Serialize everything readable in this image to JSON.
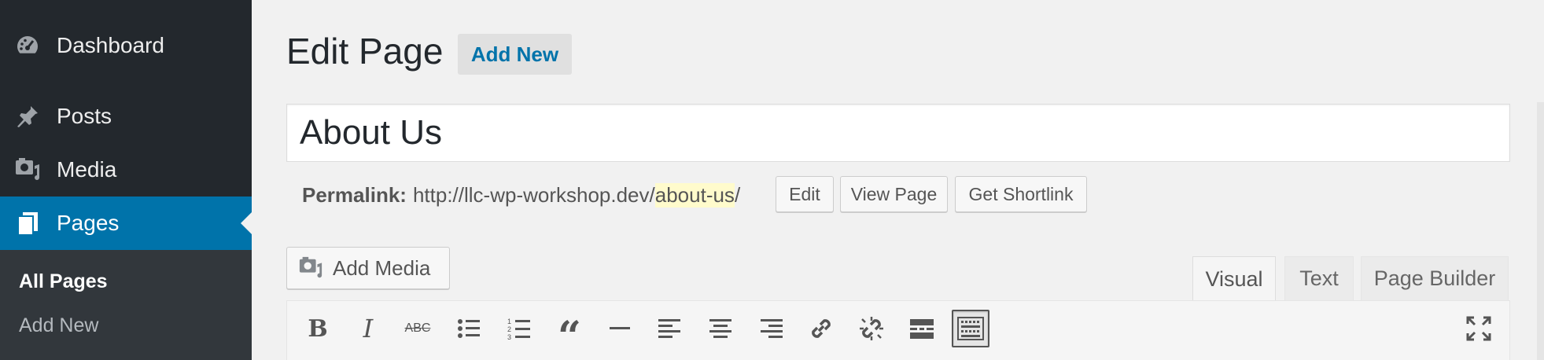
{
  "sidebar": {
    "items": [
      {
        "label": "Dashboard",
        "icon": "dashboard-icon"
      },
      {
        "label": "Posts",
        "icon": "pushpin-icon"
      },
      {
        "label": "Media",
        "icon": "media-icon"
      },
      {
        "label": "Pages",
        "icon": "pages-icon"
      }
    ],
    "submenu": [
      {
        "label": "All Pages"
      },
      {
        "label": "Add New"
      }
    ],
    "colors": {
      "background": "#23282d",
      "active": "#0073aa",
      "submenu_background": "#32373c"
    }
  },
  "header": {
    "title": "Edit Page",
    "add_new_label": "Add New"
  },
  "editor": {
    "title_value": "About Us",
    "permalink": {
      "label": "Permalink:",
      "base_url": "http://llc-wp-workshop.dev/",
      "slug": "about-us",
      "trailing": "/"
    },
    "permalink_buttons": {
      "edit": "Edit",
      "view_page": "View Page",
      "get_shortlink": "Get Shortlink"
    },
    "add_media_label": "Add Media",
    "tabs": [
      {
        "label": "Visual",
        "active": true
      },
      {
        "label": "Text",
        "active": false
      },
      {
        "label": "Page Builder",
        "active": false
      }
    ],
    "toolbar": {
      "bold": "B",
      "italic": "I",
      "strikethrough": "ABC",
      "blockquote": "“",
      "icons": [
        "bold-icon",
        "italic-icon",
        "strikethrough-icon",
        "bulleted-list-icon",
        "numbered-list-icon",
        "blockquote-icon",
        "horizontal-line-icon",
        "align-left-icon",
        "align-center-icon",
        "align-right-icon",
        "insert-link-icon",
        "remove-link-icon",
        "read-more-icon",
        "toolbar-toggle-icon",
        "fullscreen-icon"
      ]
    }
  }
}
